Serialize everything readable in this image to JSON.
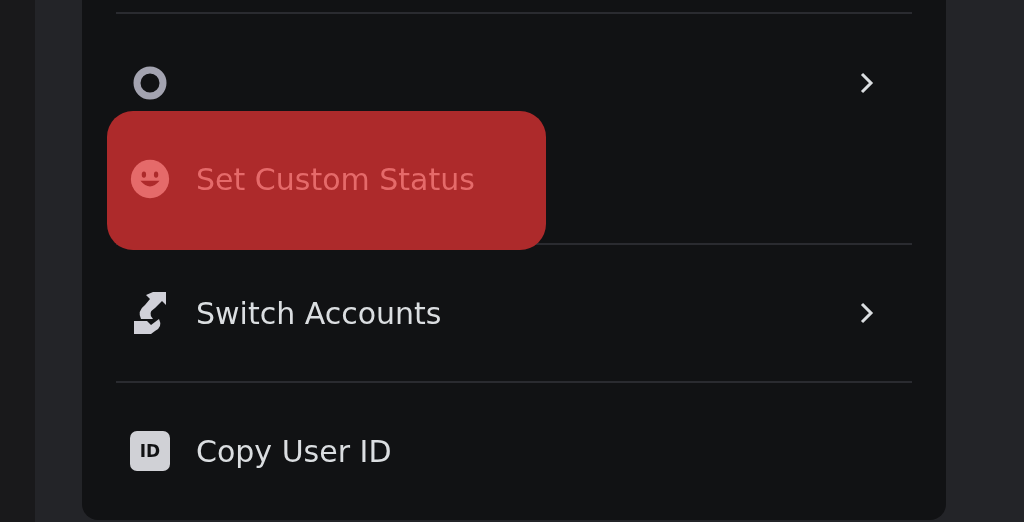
{
  "menu": {
    "sections": [
      {
        "items": [
          {
            "kind": "status-ring",
            "has_submenu": true,
            "highlighted": false
          },
          {
            "kind": "smiley",
            "label": "Set Custom Status",
            "has_submenu": false,
            "highlighted": true
          }
        ]
      },
      {
        "items": [
          {
            "kind": "swap",
            "label": "Switch Accounts",
            "has_submenu": true,
            "highlighted": false
          }
        ]
      },
      {
        "items": [
          {
            "kind": "id-badge",
            "badge_text": "ID",
            "label": "Copy User ID",
            "has_submenu": false,
            "highlighted": false
          }
        ]
      }
    ]
  }
}
